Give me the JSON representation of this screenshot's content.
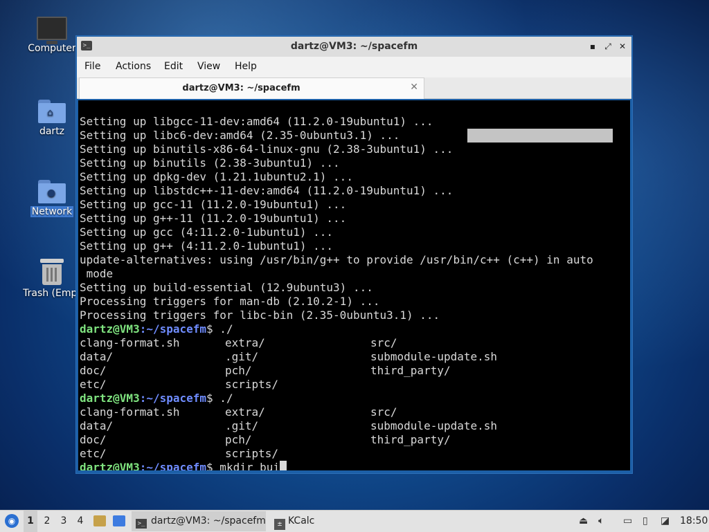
{
  "desktop": {
    "icons": [
      {
        "label": "Computer",
        "icon": "computer-icon"
      },
      {
        "label": "dartz",
        "icon": "home-folder-icon"
      },
      {
        "label": "Network",
        "icon": "network-folder-icon"
      },
      {
        "label": "Trash (Empt",
        "icon": "trash-icon"
      }
    ]
  },
  "window": {
    "title": "dartz@VM3: ~/spacefm",
    "controls": {
      "minimize": "▪",
      "maximize": "⤢",
      "close": "✕"
    },
    "menu": [
      "File",
      "Actions",
      "Edit",
      "View",
      "Help"
    ],
    "tab": {
      "label": "dartz@VM3: ~/spacefm",
      "close": "✕"
    }
  },
  "terminal": {
    "output": [
      "Setting up libgcc-11-dev:amd64 (11.2.0-19ubuntu1) ...",
      "Setting up libc6-dev:amd64 (2.35-0ubuntu3.1) ...",
      "Setting up binutils-x86-64-linux-gnu (2.38-3ubuntu1) ...",
      "Setting up binutils (2.38-3ubuntu1) ...",
      "Setting up dpkg-dev (1.21.1ubuntu2.1) ...",
      "Setting up libstdc++-11-dev:amd64 (11.2.0-19ubuntu1) ...",
      "Setting up gcc-11 (11.2.0-19ubuntu1) ...",
      "Setting up g++-11 (11.2.0-19ubuntu1) ...",
      "Setting up gcc (4:11.2.0-1ubuntu1) ...",
      "Setting up g++ (4:11.2.0-1ubuntu1) ...",
      "update-alternatives: using /usr/bin/g++ to provide /usr/bin/c++ (c++) in auto",
      " mode",
      "Setting up build-essential (12.9ubuntu3) ...",
      "Processing triggers for man-db (2.10.2-1) ...",
      "Processing triggers for libc-bin (2.35-0ubuntu3.1) ..."
    ],
    "prompt_user": "dartz@VM3",
    "prompt_path": ":~/spacefm",
    "prompt_sign": "$",
    "cmd1": " ./",
    "cmd2": " ./",
    "listing": [
      [
        "clang-format.sh",
        "extra/",
        "src/"
      ],
      [
        "data/",
        ".git/",
        "submodule-update.sh"
      ],
      [
        "doc/",
        "pch/",
        "third_party/"
      ],
      [
        "etc/",
        "scripts/",
        ""
      ]
    ],
    "current_input": " mkdir bui"
  },
  "taskbar": {
    "workspaces": [
      "1",
      "2",
      "3",
      "4"
    ],
    "tasks": [
      {
        "label": "dartz@VM3: ~/spacefm",
        "icon": "terminal-icon"
      },
      {
        "label": "KCalc",
        "icon": "calculator-icon"
      }
    ],
    "clock": "18:50"
  }
}
